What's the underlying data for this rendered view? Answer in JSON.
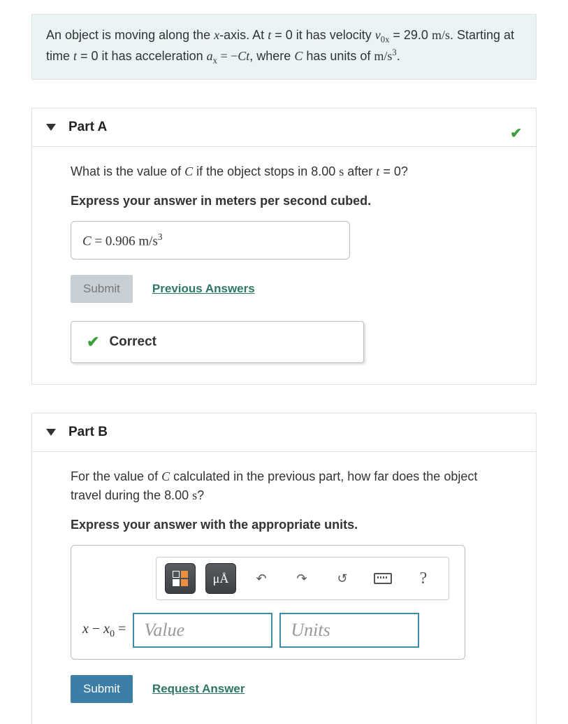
{
  "problem": {
    "text1": "An object is moving along the ",
    "var_x": "x",
    "text2": "-axis. At ",
    "var_t": "t",
    "text3": " = 0 it has velocity ",
    "var_v": "v",
    "sub_0x": "0x",
    "text4": " = 29.0 ",
    "unit_ms": "m/s",
    "text5": ". Starting at time ",
    "text6": " = 0 it has acceleration ",
    "var_a": "a",
    "sub_x": "x",
    "text7": " = −",
    "var_C": "C",
    "text8": ", where ",
    "text9": " has units of ",
    "unit_ms3_base": "m/s",
    "unit_ms3_exp": "3",
    "period": "."
  },
  "partA": {
    "title": "Part A",
    "q1": "What is the value of ",
    "var_C": "C",
    "q2": " if the object stops in 8.00 ",
    "unit_s": "s",
    "q3": " after ",
    "var_t": "t",
    "q4": " = 0?",
    "instruction": "Express your answer in meters per second cubed.",
    "ans_var": "C",
    "ans_eq": " =  0.906  ",
    "ans_unit_base": "m/s",
    "ans_unit_exp": "3",
    "submit": "Submit",
    "prev": "Previous Answers",
    "correct": "Correct"
  },
  "partB": {
    "title": "Part B",
    "q1": "For the value of ",
    "var_C": "C",
    "q2": " calculated in the previous part, how far does the object travel during the 8.00 ",
    "unit_s": "s",
    "q3": "?",
    "instruction": "Express your answer with the appropriate units.",
    "toolbar_ua": "μÅ",
    "toolbar_help": "?",
    "eq_lhs_x": "x",
    "eq_lhs_minus": " − ",
    "eq_lhs_x0": "x",
    "eq_lhs_sub0": "0",
    "eq_lhs_eq": " = ",
    "value_ph": "Value",
    "units_ph": "Units",
    "submit": "Submit",
    "request": "Request Answer"
  }
}
